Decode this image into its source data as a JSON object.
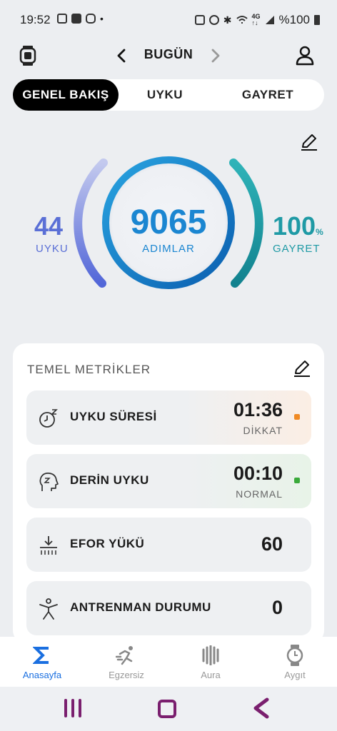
{
  "status_bar": {
    "time": "19:52",
    "battery": "%100"
  },
  "header": {
    "title": "BUGÜN"
  },
  "tabs": [
    {
      "label": "GENEL BAKIŞ",
      "active": true
    },
    {
      "label": "UYKU",
      "active": false
    },
    {
      "label": "GAYRET",
      "active": false
    }
  ],
  "rings": {
    "left": {
      "value": "44",
      "label": "UYKU",
      "color": "#5a6fd6"
    },
    "center": {
      "value": "9065",
      "label": "ADIMLAR",
      "color": "#1b86d1"
    },
    "right": {
      "value": "100",
      "unit": "%",
      "label": "GAYRET",
      "color": "#1f9aa5"
    }
  },
  "metrics_card": {
    "title": "TEMEL METRİKLER",
    "items": [
      {
        "label": "UYKU SÜRESİ",
        "value": "01:36",
        "status": "DİKKAT",
        "status_color": "#f08a24",
        "icon": "sleep-clock-icon"
      },
      {
        "label": "DERİN UYKU",
        "value": "00:10",
        "status": "NORMAL",
        "status_color": "#3aaa3a",
        "icon": "deep-sleep-icon"
      },
      {
        "label": "EFOR YÜKÜ",
        "value": "60",
        "icon": "effort-load-icon"
      },
      {
        "label": "ANTRENMAN DURUMU",
        "value": "0",
        "icon": "training-person-icon"
      }
    ]
  },
  "bottom_nav": [
    {
      "label": "Anasayfa",
      "active": true,
      "icon": "sigma-icon"
    },
    {
      "label": "Egzersiz",
      "active": false,
      "icon": "running-icon"
    },
    {
      "label": "Aura",
      "active": false,
      "icon": "aura-icon"
    },
    {
      "label": "Aygıt",
      "active": false,
      "icon": "watch-icon"
    }
  ]
}
